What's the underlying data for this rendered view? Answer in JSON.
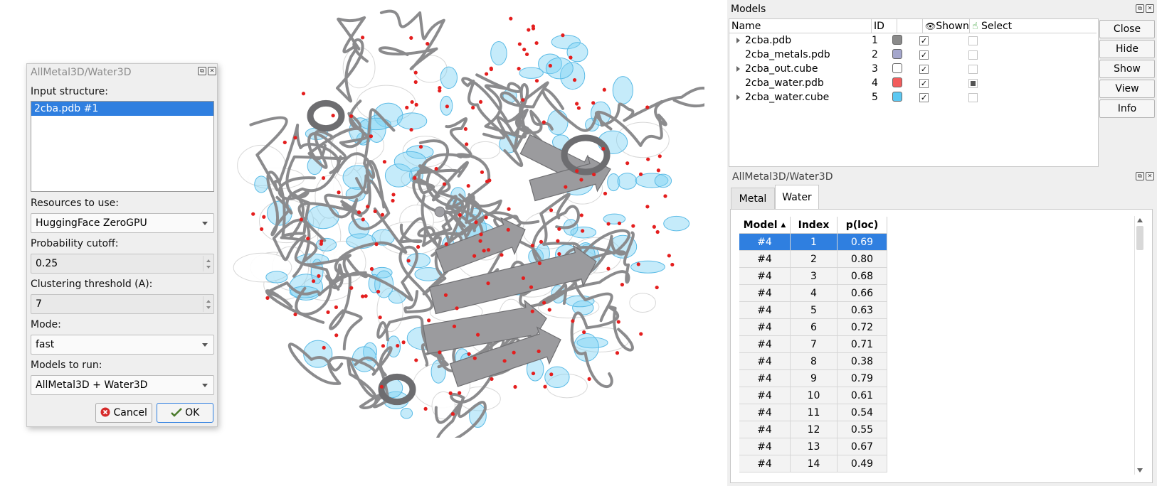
{
  "dialog": {
    "title": "AllMetal3D/Water3D",
    "input_structure_label": "Input structure:",
    "input_structures": [
      "2cba.pdb #1"
    ],
    "resources_label": "Resources to use:",
    "resources_value": "HuggingFace ZeroGPU",
    "probability_label": "Probability cutoff:",
    "probability_value": "0.25",
    "clustering_label": "Clustering threshold (A):",
    "clustering_value": "7",
    "mode_label": "Mode:",
    "mode_value": "fast",
    "models_label": "Models to run:",
    "models_value": "AllMetal3D + Water3D",
    "cancel_label": "Cancel",
    "ok_label": "OK"
  },
  "models_panel": {
    "title": "Models",
    "columns": {
      "name": "Name",
      "id": "ID",
      "shown": "Shown",
      "select": "Select"
    },
    "rows": [
      {
        "name": "2cba.pdb",
        "id": "1",
        "color": "#8a8a8a",
        "shown": true,
        "selected": false,
        "expandable": true
      },
      {
        "name": "2cba_metals.pdb",
        "id": "2",
        "color": "#a4a6cc",
        "shown": true,
        "selected": false,
        "expandable": false
      },
      {
        "name": "2cba_out.cube",
        "id": "3",
        "color": "#ffffff",
        "shown": true,
        "selected": false,
        "expandable": true
      },
      {
        "name": "2cba_water.pdb",
        "id": "4",
        "color": "#f25c5c",
        "shown": true,
        "selected": true,
        "expandable": false
      },
      {
        "name": "2cba_water.cube",
        "id": "5",
        "color": "#5cc8f2",
        "shown": true,
        "selected": false,
        "expandable": true
      }
    ],
    "buttons": [
      "Close",
      "Hide",
      "Show",
      "View",
      "Info"
    ]
  },
  "results_panel": {
    "title": "AllMetal3D/Water3D",
    "tabs": [
      "Metal",
      "Water"
    ],
    "active_tab": "Water",
    "columns": [
      "Model",
      "Index",
      "p(loc)"
    ],
    "rows": [
      [
        "#4",
        "1",
        "0.69"
      ],
      [
        "#4",
        "2",
        "0.80"
      ],
      [
        "#4",
        "3",
        "0.68"
      ],
      [
        "#4",
        "4",
        "0.66"
      ],
      [
        "#4",
        "5",
        "0.63"
      ],
      [
        "#4",
        "6",
        "0.72"
      ],
      [
        "#4",
        "7",
        "0.71"
      ],
      [
        "#4",
        "8",
        "0.38"
      ],
      [
        "#4",
        "9",
        "0.79"
      ],
      [
        "#4",
        "10",
        "0.61"
      ],
      [
        "#4",
        "11",
        "0.54"
      ],
      [
        "#4",
        "12",
        "0.55"
      ],
      [
        "#4",
        "13",
        "0.67"
      ],
      [
        "#4",
        "14",
        "0.49"
      ]
    ],
    "selected_row": 0
  },
  "colors": {
    "selection": "#2f7fe0",
    "ribbon": "#8b8b8d",
    "density": "#7fd3f5",
    "water": "#e41e1e"
  }
}
